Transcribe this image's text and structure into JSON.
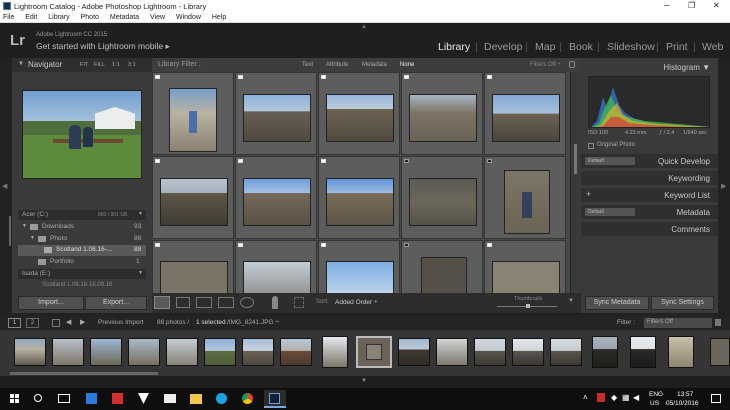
{
  "window": {
    "title": "Lightroom Catalog - Adobe Photoshop Lightroom - Library",
    "minimize": "─",
    "restore": "❐",
    "close": "✕"
  },
  "menu": [
    "File",
    "Edit",
    "Library",
    "Photo",
    "Metadata",
    "View",
    "Window",
    "Help"
  ],
  "identity": {
    "logo": "Lr",
    "product": "Adobe Lightroom CC 2015",
    "subtitle": "Get started with Lightroom mobile",
    "subtitle_arrow": "▸"
  },
  "modules": [
    "Library",
    "Develop",
    "Map",
    "Book",
    "Slideshow",
    "Print",
    "Web"
  ],
  "active_module": "Library",
  "separator": "|",
  "navigator": {
    "title": "Navigator",
    "zoom_options": [
      "FIT",
      "FILL",
      "1:1",
      "3:1"
    ]
  },
  "folders": {
    "volume": "Acer (C:)",
    "volume_space": "860 / 901 GB",
    "items": [
      {
        "name": "Downloads",
        "count": "93"
      },
      {
        "name": "Photo",
        "count": "88"
      },
      {
        "name": "Scotland 1.08.16-...",
        "count": "88"
      },
      {
        "name": "Portfolio",
        "count": "1"
      }
    ],
    "volume2": "Isada (E:)",
    "volume2_item": "Scotland 1.08.16-16.08.16"
  },
  "buttons": {
    "import": "Import...",
    "export": "Export...",
    "sync_metadata": "Sync Metadata",
    "sync_settings": "Sync Settings"
  },
  "filter_bar": {
    "label": "Library Filter :",
    "options": [
      "Text",
      "Attribute",
      "Metadata",
      "None"
    ],
    "active": "None",
    "filters_off": "Filters Off ÷"
  },
  "toolbar": {
    "sort_label": "Sort:",
    "sort_value": "Added Order ÷",
    "thumbnails_label": "Thumbnails"
  },
  "histogram": {
    "title": "Histogram",
    "iso": "ISO 100",
    "focal": "4.23 mm",
    "aperture": "ƒ / 2.4",
    "shutter": "1/640 sec",
    "original_photo": "Original Photo"
  },
  "right_panels": {
    "quick_develop": "Quick Develop",
    "keywording": "Keywording",
    "keyword_list": "Keyword List",
    "metadata": "Metadata",
    "comments": "Comments",
    "default_label": "Default",
    "plus": "+"
  },
  "filmstrip": {
    "page1": "1",
    "page2": "2",
    "previous_import": "Previous Import",
    "count_text": "88 photos /",
    "selected_text": "1 selected",
    "filename": "/IMG_8241.JPG ÷",
    "filter_label": "Filter :",
    "filter_value": "Filters Off"
  },
  "taskbar": {
    "lang": "ENG",
    "region": "US",
    "time": "13:57",
    "date": "05/10/2016"
  },
  "colors": {
    "accent": "#3b78c4",
    "panel_bg": "#3a3a3a",
    "grid_bg": "#494949",
    "sky": "#7fa8d6",
    "stone": "#6e6455"
  }
}
